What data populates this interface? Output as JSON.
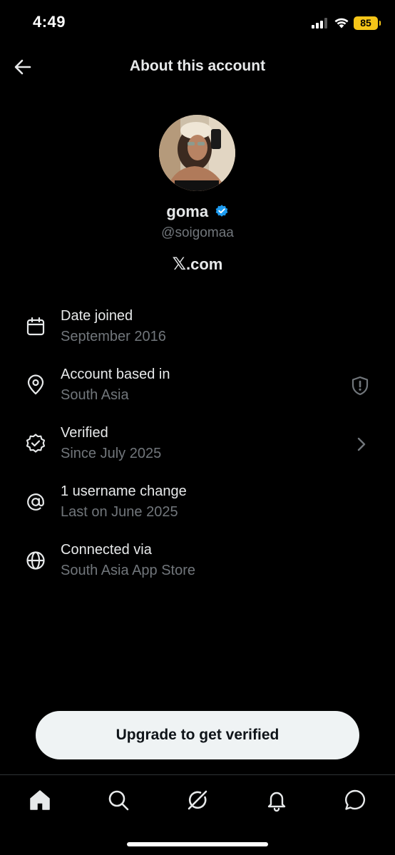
{
  "status_bar": {
    "time": "4:49",
    "battery_level": "85",
    "battery_color": "#f5c518"
  },
  "header": {
    "title": "About this account",
    "back_icon": "arrow-left-icon"
  },
  "profile": {
    "display_name": "goma",
    "verified": true,
    "verified_color": "#1d9bf0",
    "handle": "@soigomaa",
    "site_logo": "𝕏",
    "site_suffix": ".com"
  },
  "info_rows": [
    {
      "icon": "calendar-icon",
      "title": "Date joined",
      "subtitle": "September 2016"
    },
    {
      "icon": "location-pin-icon",
      "title": "Account based in",
      "subtitle": "South Asia",
      "trailing_icon": "shield-alert-icon"
    },
    {
      "icon": "verified-check-icon",
      "title": "Verified",
      "subtitle": "Since July 2025",
      "trailing_icon": "chevron-right-icon"
    },
    {
      "icon": "at-sign-icon",
      "title": "1 username change",
      "subtitle": "Last on June 2025"
    },
    {
      "icon": "globe-icon",
      "title": "Connected via",
      "subtitle": "South Asia App Store"
    }
  ],
  "upgrade_button": {
    "label": "Upgrade to get verified"
  },
  "tab_bar": {
    "tabs": [
      {
        "name": "home",
        "icon": "home-icon",
        "active": true
      },
      {
        "name": "search",
        "icon": "search-icon"
      },
      {
        "name": "grok",
        "icon": "grok-icon"
      },
      {
        "name": "notifications",
        "icon": "bell-icon"
      },
      {
        "name": "messages",
        "icon": "message-icon"
      }
    ]
  },
  "colors": {
    "background": "#000000",
    "primary_text": "#e7e9ea",
    "secondary_text": "#71767b",
    "button_bg": "#eff3f4"
  }
}
